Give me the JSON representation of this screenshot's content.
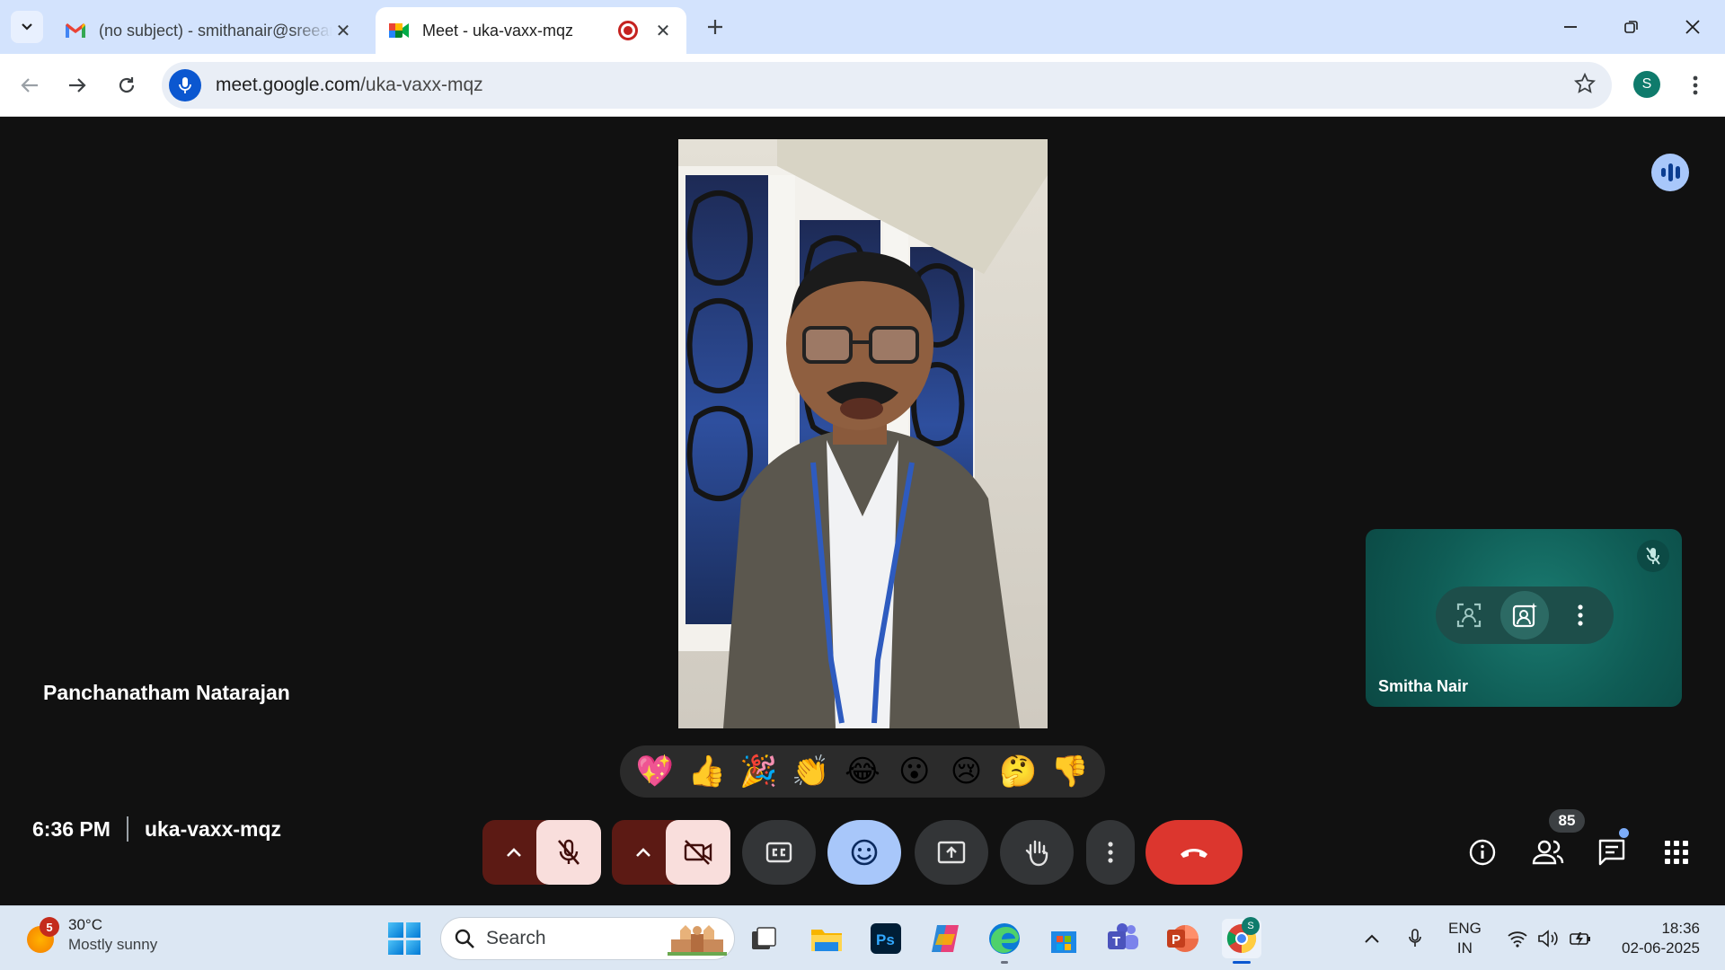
{
  "browser": {
    "tabs": [
      {
        "title": "(no subject) - smithanair@sreeanu"
      },
      {
        "title": "Meet - uka-vaxx-mqz"
      }
    ],
    "url_host": "meet.google.com",
    "url_path": "/uka-vaxx-mqz",
    "profile_initial": "S"
  },
  "meet": {
    "main_participant": "Panchanatham Natarajan",
    "self_name": "Smitha Nair",
    "time": "6:36 PM",
    "meeting_code": "uka-vaxx-mqz",
    "participant_count": "85",
    "reactions": [
      "💖",
      "👍",
      "🎉",
      "👏",
      "😂",
      "😮",
      "😢",
      "🤔",
      "👎"
    ]
  },
  "taskbar": {
    "weather_badge": "5",
    "temperature": "30°C",
    "condition": "Mostly sunny",
    "search_label": "Search",
    "lang_line1": "ENG",
    "lang_line2": "IN",
    "clock_time": "18:36",
    "clock_date": "02-06-2025"
  },
  "colors": {
    "leave": "#dc362e",
    "mic_off_bg": "#f9dedc",
    "emoji_active": "#a8c7fa",
    "self_tile": "#0f5c55"
  }
}
